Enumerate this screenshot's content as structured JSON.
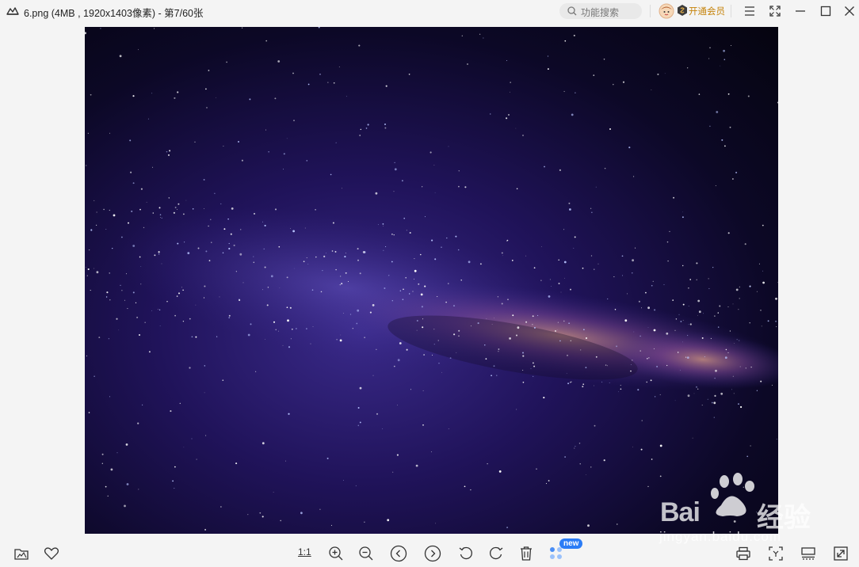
{
  "window": {
    "title": "6.png (4MB , 1920x1403像素) - 第7/60张",
    "search_placeholder": "功能搜索",
    "vip_label": "开通会员"
  },
  "toolbar": {
    "actual_size_label": "1:1",
    "new_badge": "new"
  },
  "watermark": {
    "brand_latin": "Bai",
    "brand_cn": "经验",
    "url": "jingyan.baidu.com"
  },
  "colors": {
    "accent": "#2b7cf6",
    "vip": "#c5830b",
    "background": "#f4f4f4"
  }
}
